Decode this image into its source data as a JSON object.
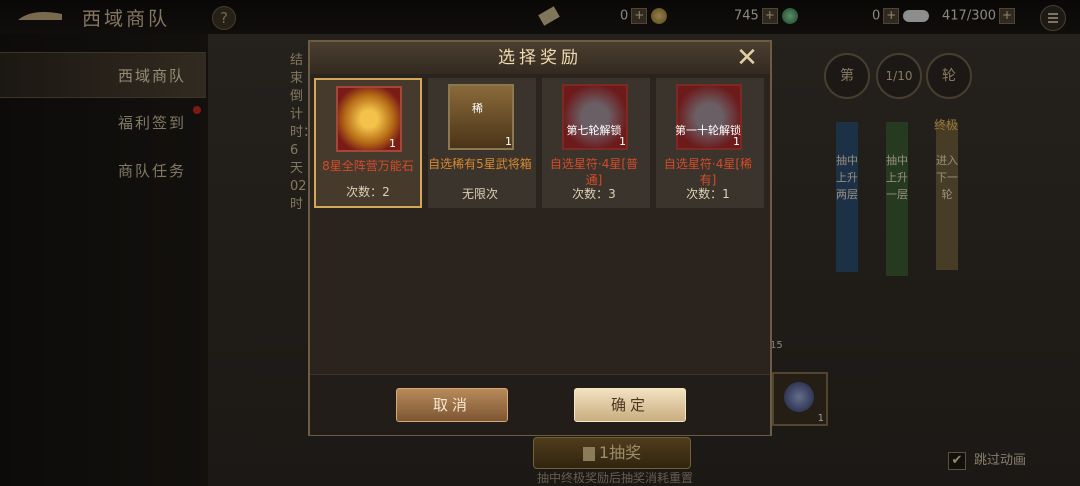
{
  "header": {
    "title": "西域商队",
    "help": "?",
    "resources": [
      {
        "value": "0",
        "icon": "banknote-icon"
      },
      {
        "value": "745",
        "icon": "jade-coin-icon"
      },
      {
        "value": "0",
        "icon": "silver-ingot-icon"
      },
      {
        "value": "417/300",
        "icon": "stamina-icon"
      }
    ],
    "plus": "+"
  },
  "sidebar": {
    "items": [
      {
        "label": "西域商队",
        "active": true
      },
      {
        "label": "福利签到",
        "badge": true
      },
      {
        "label": "商队任务"
      }
    ]
  },
  "board": {
    "countdown_vertical": "结束倒计时：6天02时",
    "round_label_first": "第",
    "round_counter": "1/10",
    "round_label_last": "轮",
    "banners": [
      "抽中上升两层",
      "抽中上升一层",
      "进入下一轮"
    ],
    "banner_top_tag": "终极",
    "side_card_count": "1",
    "side_counter": "15",
    "draw_button": "1抽奖",
    "draw_hint": "抽中终极奖励后抽奖消耗重置",
    "skip_animation": "跳过动画"
  },
  "modal": {
    "title": "选择奖励",
    "cancel": "取消",
    "confirm": "确定",
    "cards": [
      {
        "name": "8星全阵营万能石",
        "uses": "次数：2",
        "count": "1",
        "lock": "",
        "selected": true,
        "icon": "gold-stone-icon"
      },
      {
        "name": "自选稀有5星武将箱",
        "uses": "无限次",
        "count": "1",
        "lock": "",
        "tag": "稀",
        "selected": false,
        "icon": "treasure-chest-icon"
      },
      {
        "name": "自选星符·4星[普通]",
        "uses": "次数：3",
        "count": "1",
        "lock": "第七轮解锁",
        "selected": false,
        "icon": "star-talisman-icon"
      },
      {
        "name": "自选星符·4星[稀有]",
        "uses": "次数：1",
        "count": "1",
        "lock": "第一十轮解锁",
        "selected": false,
        "icon": "star-talisman-icon"
      }
    ]
  }
}
